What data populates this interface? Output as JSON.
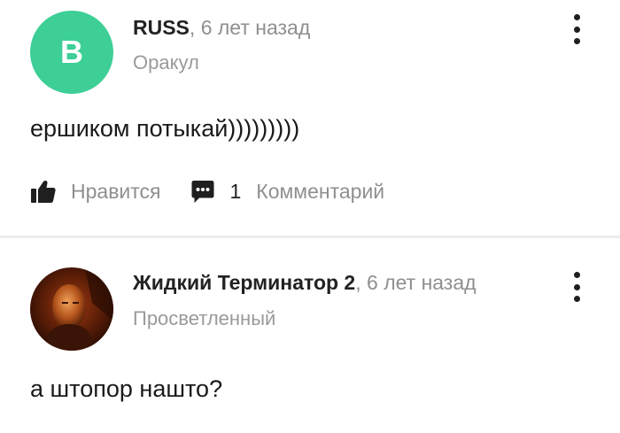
{
  "comments": [
    {
      "avatar_letter": "B",
      "avatar_color": "#3dcf96",
      "author": "RUSS",
      "time": "6 лет назад",
      "rank": "Оракул",
      "text": "ершиком потыкай)))))))))",
      "like_label": "Нравится",
      "reply_count": "1",
      "comment_label": "Комментарий"
    },
    {
      "avatar_icon": "user-photo-avatar",
      "author": "Жидкий Терминатор 2",
      "time": "6 лет назад",
      "rank": "Просветленный",
      "text": "а штопор нашто?"
    }
  ],
  "icons": {
    "like": "thumbs-up-icon",
    "comment": "comment-bubble-icon",
    "menu": "more-vertical-icon"
  }
}
